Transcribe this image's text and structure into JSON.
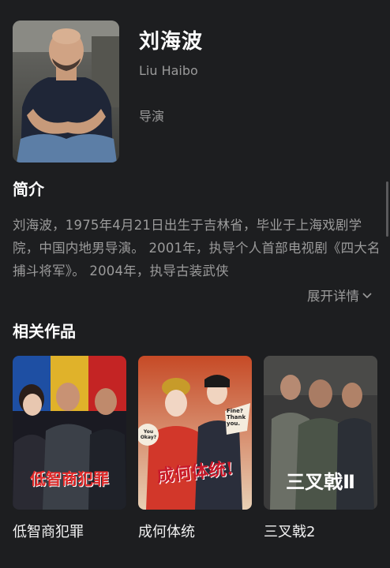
{
  "person": {
    "name": "刘海波",
    "name_en": "Liu Haibo",
    "role": "导演"
  },
  "bio": {
    "title": "简介",
    "text": "刘海波，1975年4月21日出生于吉林省，毕业于上海戏剧学院，中国内地男导演。 2001年，执导个人首部电视剧《四大名捕斗将军》。 2004年，执导古装武侠",
    "expand_label": "展开详情"
  },
  "works": {
    "title": "相关作品",
    "items": [
      {
        "title": "低智商犯罪",
        "poster_text": "低智商犯罪"
      },
      {
        "title": "成何体统",
        "poster_text": "成何体统!",
        "poster_badges": [
          "Fine? Thank you.",
          "You Okay?"
        ]
      },
      {
        "title": "三叉戟2",
        "poster_text": "三叉戟Ⅱ"
      }
    ]
  },
  "icons": {
    "expand": "chevron-down-icon"
  },
  "colors": {
    "background": "#1d1e20",
    "text_primary": "#ffffff",
    "text_secondary": "#9b9b9b"
  }
}
